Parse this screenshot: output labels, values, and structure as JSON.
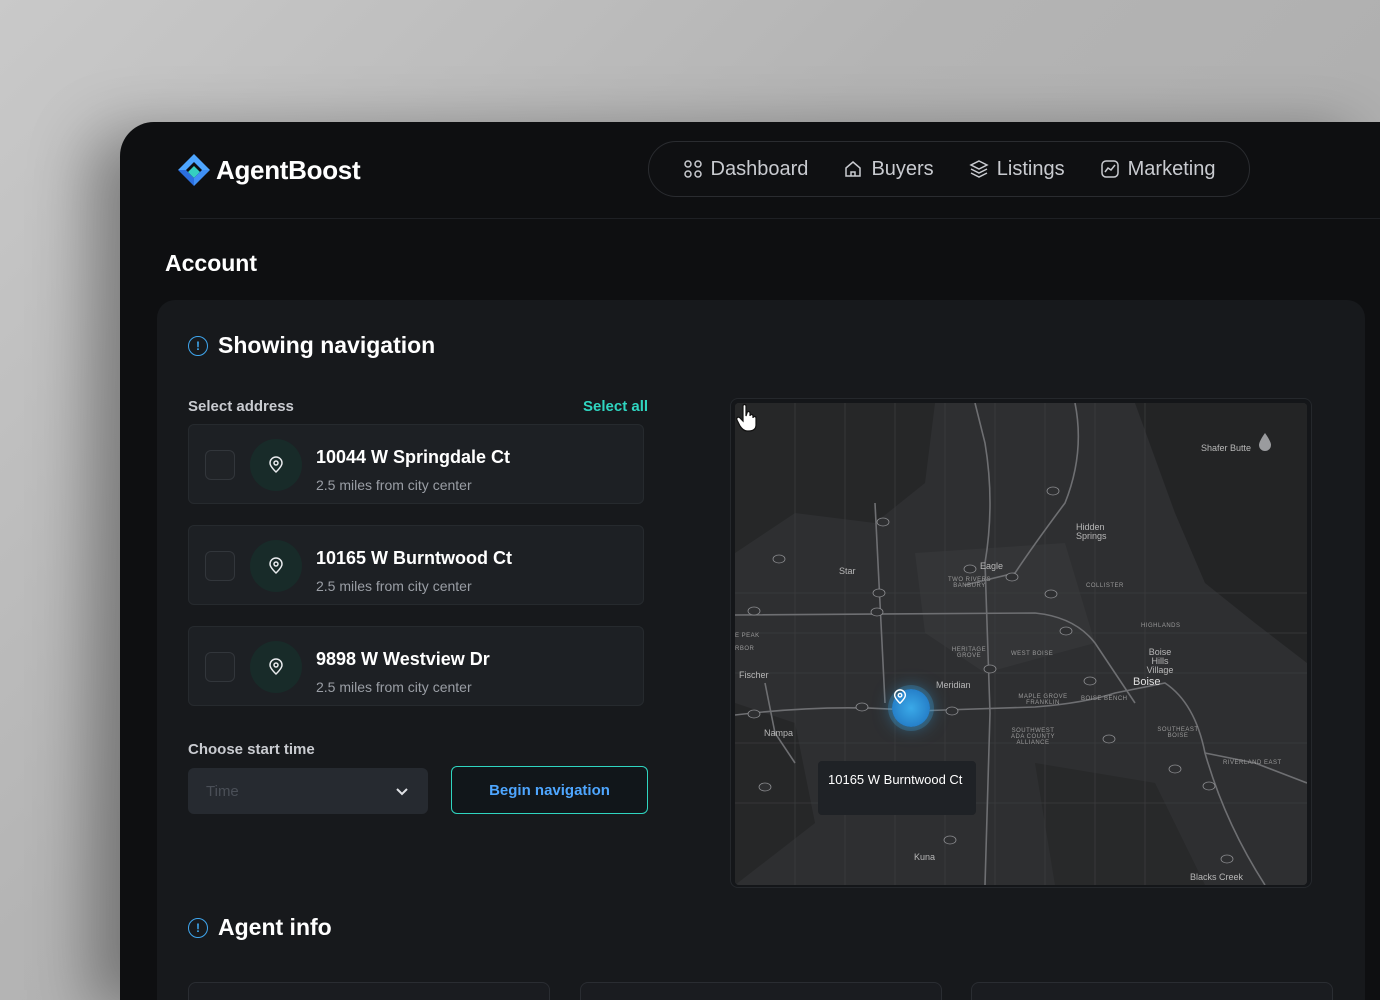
{
  "brand": {
    "name": "AgentBoost"
  },
  "nav": [
    {
      "label": "Dashboard",
      "icon": "grid-icon"
    },
    {
      "label": "Buyers",
      "icon": "home-icon"
    },
    {
      "label": "Listings",
      "icon": "layers-icon"
    },
    {
      "label": "Marketing",
      "icon": "chart-icon"
    }
  ],
  "page": {
    "title": "Account"
  },
  "showing": {
    "title": "Showing navigation",
    "select_address_label": "Select address",
    "select_all": "Select all",
    "addresses": [
      {
        "title": "10044 W Springdale Ct",
        "subtitle": "2.5 miles from city center"
      },
      {
        "title": "10165 W Burntwood Ct",
        "subtitle": "2.5 miles from city center"
      },
      {
        "title": "9898 W Westview Dr",
        "subtitle": "2.5 miles from city center"
      }
    ],
    "start_time_label": "Choose start time",
    "time_placeholder": "Time",
    "begin_button": "Begin navigation"
  },
  "map": {
    "tooltip": "10165 W Burntwood Ct",
    "places": {
      "shafer_butte": "Shafer Butte",
      "hidden_springs": "Hidden Springs",
      "eagle": "Eagle",
      "star": "Star",
      "two_rivers": "TWO RIVERS BANBURY",
      "collister": "COLLISTER",
      "highlands": "HIGHLANDS",
      "boise_hills": "Boise Hills Village",
      "boise": "Boise",
      "heritage_grove": "HERITAGE GROVE",
      "west_boise": "WEST BOISE",
      "meridian": "Meridian",
      "maple_grove": "MAPLE GROVE FRANKLIN",
      "boise_bench": "BOISE BENCH",
      "southwest_ada": "SOUTHWEST ADA COUNTY ALLIANCE",
      "southeast_boise": "SOUTHEAST BOISE",
      "riverland_east": "RIVERLAND EAST",
      "nampa": "Nampa",
      "fischer": "Fischer",
      "peak": "E PEAK",
      "arbor": "RBOR",
      "kuna": "Kuna",
      "blacks_creek": "Blacks Creek"
    }
  },
  "agent_info": {
    "title": "Agent info"
  },
  "colors": {
    "accent_teal": "#2fd5c0",
    "accent_blue": "#3fa6ee",
    "panel": "#17191c"
  }
}
